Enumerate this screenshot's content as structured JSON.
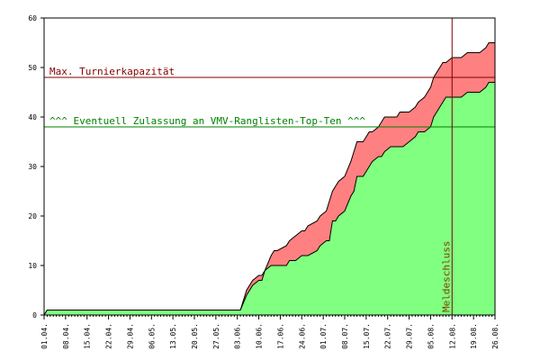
{
  "chart_data": {
    "type": "area",
    "title": "",
    "xlabel": "",
    "ylabel": "",
    "ylim": [
      0,
      60
    ],
    "y_ticks": [
      0,
      10,
      20,
      30,
      40,
      50,
      60
    ],
    "x_tick_labels": [
      "01.04.",
      "08.04.",
      "15.04.",
      "22.04.",
      "29.04.",
      "06.05.",
      "13.05.",
      "20.05.",
      "27.05.",
      "03.06.",
      "10.06.",
      "17.06.",
      "24.06.",
      "01.07.",
      "08.07.",
      "15.07.",
      "22.07.",
      "29.07.",
      "05.08.",
      "12.08.",
      "19.08.",
      "26.08."
    ],
    "grid": false,
    "colors": {
      "upper_fill": "#ff8080",
      "lower_fill": "#80ff80",
      "capacity_line": "#800000",
      "topten_line": "#008000",
      "deadline_line": "#800000",
      "deadline_text": "#804000"
    },
    "series": [
      {
        "days": [
          0,
          1,
          64,
          66,
          68,
          70,
          71,
          72,
          74,
          75,
          76,
          79,
          80,
          82,
          84,
          85,
          86,
          89,
          90,
          92,
          93,
          94,
          95,
          96,
          98,
          100,
          101,
          102,
          103,
          104,
          106,
          107,
          109,
          110,
          111,
          113,
          115,
          116,
          117,
          119,
          121,
          122,
          124,
          126,
          127,
          129,
          130,
          131,
          133,
          136,
          138,
          140,
          142,
          144,
          145,
          147
        ],
        "values": [
          0,
          1,
          1,
          4,
          6,
          7,
          7,
          9,
          10,
          10,
          10,
          10,
          11,
          11,
          12,
          12,
          12,
          13,
          14,
          15,
          15,
          19,
          19,
          20,
          21,
          24,
          25,
          28,
          28,
          28,
          30,
          31,
          32,
          32,
          33,
          34,
          34,
          34,
          34,
          35,
          36,
          37,
          37,
          38,
          40,
          42,
          43,
          44,
          44,
          44,
          45,
          45,
          45,
          46,
          47,
          47
        ]
      },
      {
        "days": [
          0,
          1,
          64,
          66,
          68,
          70,
          71,
          72,
          74,
          75,
          76,
          79,
          80,
          82,
          84,
          85,
          86,
          89,
          90,
          92,
          93,
          94,
          95,
          96,
          98,
          100,
          101,
          102,
          103,
          104,
          106,
          107,
          109,
          110,
          111,
          113,
          115,
          116,
          117,
          119,
          121,
          122,
          124,
          126,
          127,
          129,
          130,
          131,
          133,
          136,
          138,
          140,
          142,
          144,
          145,
          147
        ],
        "values": [
          0,
          1,
          1,
          5,
          7,
          8,
          8,
          9,
          12,
          13,
          13,
          14,
          15,
          16,
          17,
          17,
          18,
          19,
          20,
          21,
          23,
          25,
          26,
          27,
          28,
          31,
          33,
          35,
          35,
          35,
          37,
          37,
          38,
          39,
          40,
          40,
          40,
          41,
          41,
          41,
          42,
          43,
          44,
          46,
          48,
          50,
          51,
          51,
          52,
          52,
          53,
          53,
          53,
          54,
          55,
          55
        ]
      }
    ],
    "reference_lines": [
      {
        "orientation": "horizontal",
        "y": 48,
        "label": "Max. Turnierkapazität"
      },
      {
        "orientation": "horizontal",
        "y": 38,
        "label": "^^^ Eventuell Zulassung an VMV-Ranglisten-Top-Ten ^^^"
      },
      {
        "orientation": "vertical",
        "x_day": 133,
        "label": "Meldeschluss"
      }
    ]
  }
}
